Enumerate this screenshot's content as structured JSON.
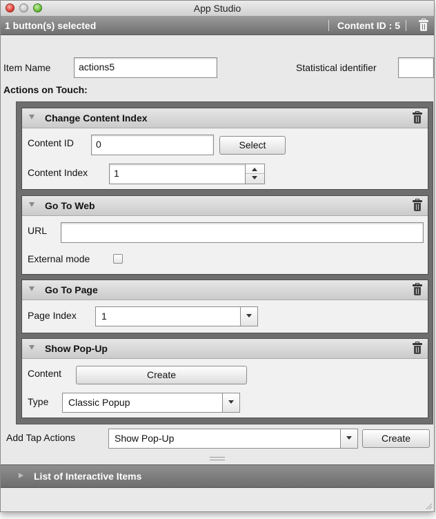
{
  "window": {
    "title": "App Studio"
  },
  "header": {
    "selected_text": "1 button(s) selected",
    "content_id_text": "Content ID : 5"
  },
  "item": {
    "name_label": "Item Name",
    "name_value": "actions5",
    "stat_label": "Statistical identifier",
    "stat_value": "",
    "actions_heading": "Actions on Touch:"
  },
  "panels": {
    "change_content": {
      "title": "Change Content Index",
      "content_id_label": "Content ID",
      "content_id_value": "0",
      "select_button": "Select",
      "content_index_label": "Content Index",
      "content_index_value": "1"
    },
    "go_to_web": {
      "title": "Go To Web",
      "url_label": "URL",
      "url_value": "",
      "external_label": "External mode",
      "external_checked": false
    },
    "go_to_page": {
      "title": "Go To Page",
      "page_index_label": "Page Index",
      "page_index_value": "1"
    },
    "show_popup": {
      "title": "Show Pop-Up",
      "content_label": "Content",
      "create_button": "Create",
      "type_label": "Type",
      "type_value": "Classic Popup"
    }
  },
  "add_tap": {
    "label": "Add Tap Actions",
    "selected": "Show Pop-Up",
    "create_button": "Create"
  },
  "list": {
    "title": "List of Interactive Items"
  }
}
